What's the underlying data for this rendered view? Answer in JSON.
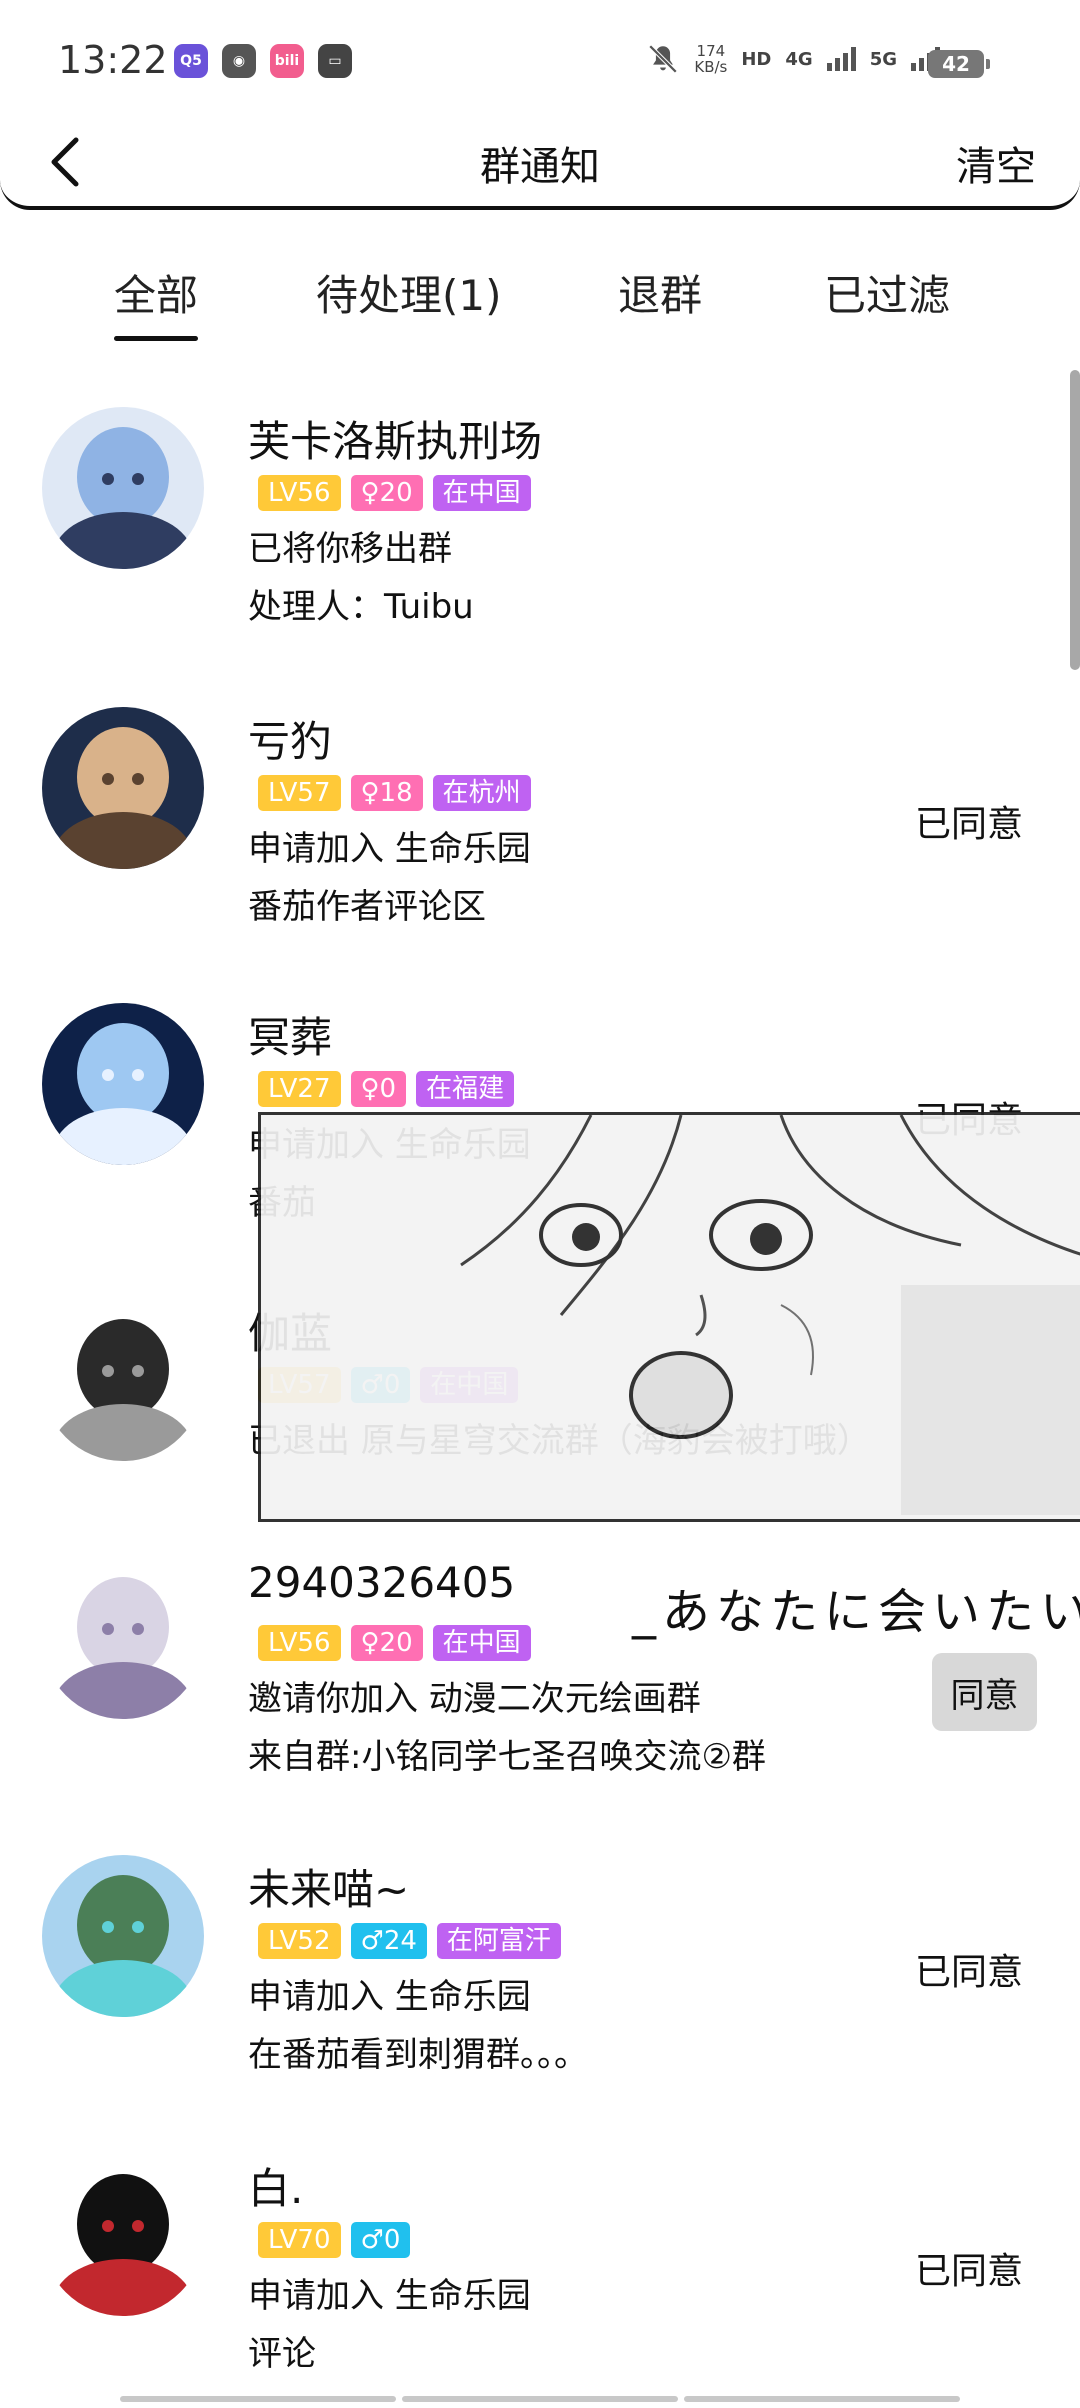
{
  "status_bar": {
    "time": "13:22",
    "app_icons": [
      {
        "icon": "qq-icon",
        "label": "Q5",
        "color": "#6a52d9"
      },
      {
        "icon": "compass-icon",
        "label": "◉",
        "color": "#555555"
      },
      {
        "icon": "bilibili-icon",
        "label": "bili",
        "color": "#f25d8e"
      },
      {
        "icon": "mail-icon",
        "label": "▭",
        "color": "#444444"
      }
    ],
    "speed_value": "174",
    "speed_unit": "KB/s",
    "hd": "HD",
    "net1": "4G",
    "net2": "5G",
    "battery": "42"
  },
  "header": {
    "title": "群通知",
    "clear_label": "清空"
  },
  "tabs": [
    {
      "label": "全部",
      "active": true
    },
    {
      "label": "待处理(1)",
      "active": false
    },
    {
      "label": "退群",
      "active": false
    },
    {
      "label": "已过滤",
      "active": false
    }
  ],
  "items": [
    {
      "name": "芙卡洛斯执刑场",
      "lv": "LV56",
      "gender": "f",
      "age": "20",
      "loc": "在中国",
      "line1": "已将你移出群",
      "line2": "处理人：Tuibu",
      "status": "",
      "avatar_colors": [
        "#dfe8f5",
        "#8fb3e4",
        "#2f3d61"
      ]
    },
    {
      "name": "亏犳",
      "lv": "LV57",
      "gender": "f",
      "age": "18",
      "loc": "在杭州",
      "line1": "申请加入 生命乐园",
      "line2": "番茄作者评论区",
      "status": "已同意",
      "avatar_colors": [
        "#1e2d4a",
        "#d9b28a",
        "#5a4230"
      ]
    },
    {
      "name": "冥葬",
      "lv": "LV27",
      "gender": "f",
      "age": "0",
      "loc": "在福建",
      "line1": "申请加入 生命乐园",
      "line2": "番茄",
      "status": "已同意",
      "avatar_colors": [
        "#0e2148",
        "#9ec8f2",
        "#e7f1ff"
      ]
    },
    {
      "name": "伽蓝",
      "lv": "LV57",
      "gender": "m",
      "age": "0",
      "loc": "在中国",
      "line1": "已退出 原与星穹交流群（海豹会被打哦）",
      "line2": "",
      "status": "",
      "avatar_colors": [
        "#ffffff",
        "#2a2a2a",
        "#9a9a9a"
      ]
    },
    {
      "name": "2940326405",
      "lv": "LV56",
      "gender": "f",
      "age": "20",
      "loc": "在中国",
      "line1": "邀请你加入 动漫二次元绘画群",
      "line2": "来自群:小铭同学七圣召唤交流②群",
      "status": "",
      "button": "同意",
      "avatar_colors": [
        "#ffffff",
        "#d9d4e4",
        "#8d7fa8"
      ]
    },
    {
      "name": "未来喵~",
      "lv": "LV52",
      "gender": "m",
      "age": "24",
      "loc": "在阿富汗",
      "line1": "申请加入 生命乐园",
      "line2": "在番茄看到刺猬群。。。",
      "status": "已同意",
      "avatar_colors": [
        "#a9d3ef",
        "#4b7f57",
        "#5fd1d8"
      ]
    },
    {
      "name": "白.",
      "lv": "LV70",
      "gender": "m",
      "age": "0",
      "loc": "",
      "line1": "申请加入 生命乐园",
      "line2": "评论",
      "status": "已同意",
      "avatar_colors": [
        "#ffffff",
        "#111111",
        "#c2282e"
      ]
    }
  ],
  "overlay_caption": "_あなたに会いたい"
}
